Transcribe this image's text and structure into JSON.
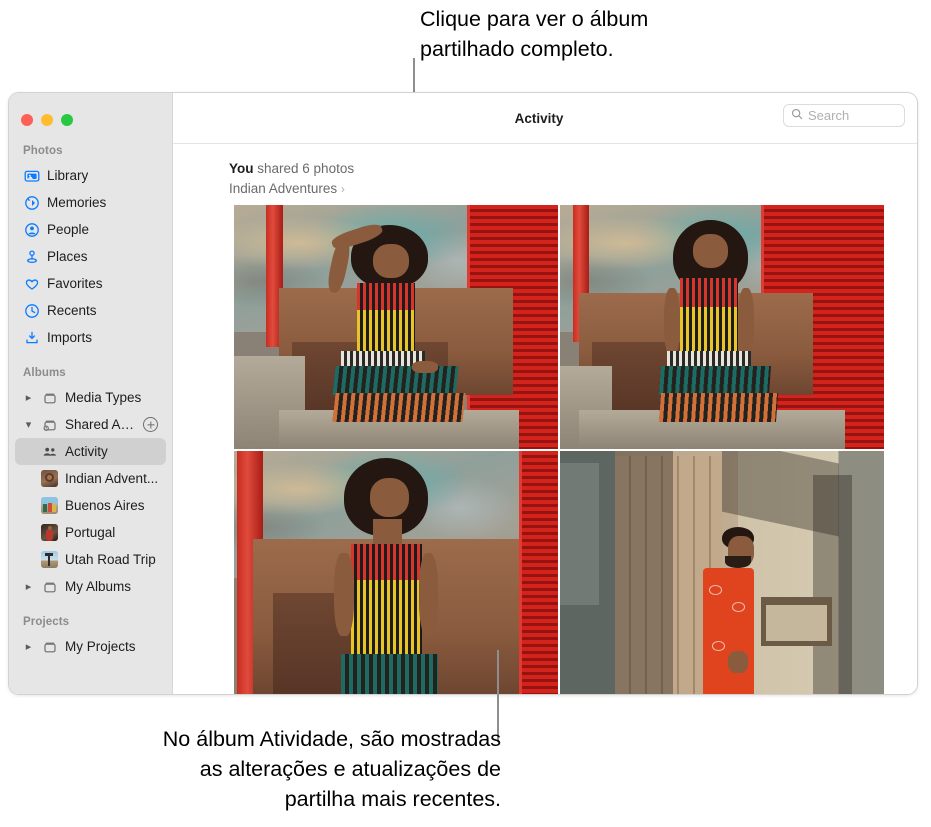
{
  "callouts": {
    "top": "Clique para ver o álbum\npartilhado completo.",
    "bottom": "No álbum Atividade, são mostradas\nas alterações e atualizações de\npartilha mais recentes."
  },
  "window": {
    "traffic_lights": [
      "close",
      "minimize",
      "zoom"
    ],
    "colors": {
      "close": "#ff5f57",
      "minimize": "#febc2e",
      "zoom": "#28c840",
      "sidebar_bg": "#e6e6e6",
      "selection": "#d0d0d0",
      "accent_icon": "#0a7cff"
    }
  },
  "toolbar": {
    "title": "Activity",
    "search": {
      "placeholder": "Search",
      "value": "",
      "icon": "search-icon"
    }
  },
  "sidebar": {
    "sections": [
      {
        "title": "Photos",
        "items": [
          {
            "label": "Library",
            "icon": "library-icon"
          },
          {
            "label": "Memories",
            "icon": "memories-icon"
          },
          {
            "label": "People",
            "icon": "people-icon"
          },
          {
            "label": "Places",
            "icon": "places-pin-icon"
          },
          {
            "label": "Favorites",
            "icon": "heart-icon"
          },
          {
            "label": "Recents",
            "icon": "clock-icon"
          },
          {
            "label": "Imports",
            "icon": "import-icon"
          }
        ]
      },
      {
        "title": "Albums",
        "items": [
          {
            "label": "Media Types",
            "icon": "album-box-icon",
            "disclosure": "collapsed"
          },
          {
            "label": "Shared Albu...",
            "icon": "shared-album-icon",
            "disclosure": "expanded",
            "add_button": "add-shared-album-button"
          },
          {
            "label": "Activity",
            "icon": "activity-people-icon",
            "selected": true,
            "nested": true
          },
          {
            "label": "Indian Advent...",
            "icon": "album-thumbnail",
            "nested": true
          },
          {
            "label": "Buenos Aires",
            "icon": "album-thumbnail",
            "nested": true
          },
          {
            "label": "Portugal",
            "icon": "album-thumbnail",
            "nested": true
          },
          {
            "label": "Utah Road Trip",
            "icon": "album-thumbnail",
            "nested": true
          },
          {
            "label": "My Albums",
            "icon": "album-box-icon",
            "disclosure": "collapsed"
          }
        ]
      },
      {
        "title": "Projects",
        "items": [
          {
            "label": "My Projects",
            "icon": "album-box-icon",
            "disclosure": "collapsed"
          }
        ]
      }
    ]
  },
  "activity": {
    "actor": "You",
    "action": "shared 6 photos",
    "album_name": "Indian Adventures",
    "album_chevron": "›",
    "photos": [
      {
        "alt": "Woman in striped dress seated, hand on head, teal weathered wall with red shutter"
      },
      {
        "alt": "Woman in striped dress seated, hands on lap, teal weathered wall with red shutter"
      },
      {
        "alt": "Woman in striped dress leaning back, eyes closed, red pillar and brown bench"
      },
      {
        "alt": "Man in orange patterned shirt standing beside weathered wooden door"
      }
    ]
  }
}
